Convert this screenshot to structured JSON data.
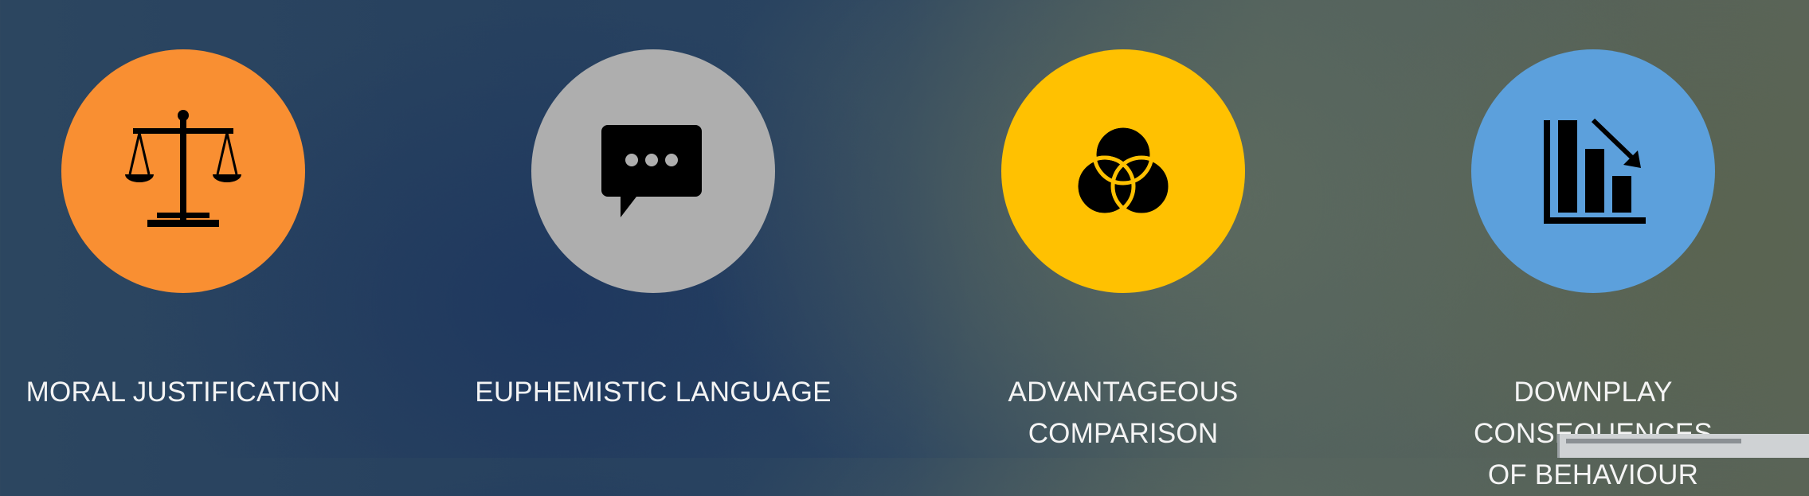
{
  "items": [
    {
      "icon": "scales-of-justice-icon",
      "color": "#f98f32",
      "label_lines": [
        "MORAL JUSTIFICATION"
      ]
    },
    {
      "icon": "speech-bubble-icon",
      "color": "#aeaeae",
      "label_lines": [
        "EUPHEMISTIC LANGUAGE"
      ]
    },
    {
      "icon": "venn-diagram-icon",
      "color": "#ffc101",
      "label_lines": [
        "ADVANTAGEOUS",
        "COMPARISON"
      ]
    },
    {
      "icon": "declining-bar-chart-icon",
      "color": "#5ca0dc",
      "label_lines": [
        "DOWNPLAY CONSEQUENCES",
        "OF BEHAVIOUR"
      ]
    }
  ]
}
